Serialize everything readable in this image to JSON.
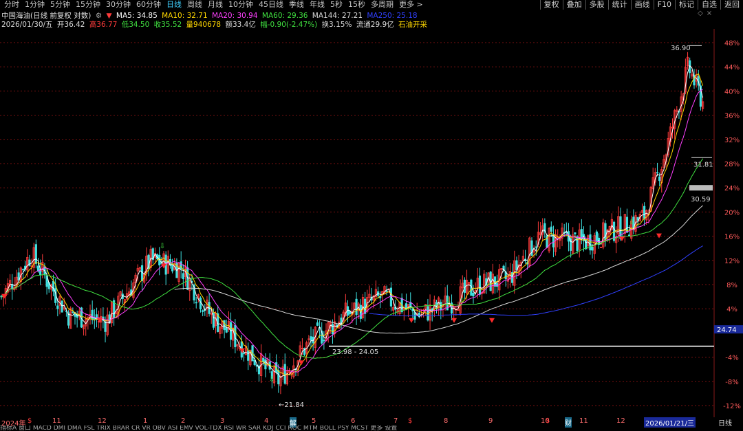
{
  "periods": [
    "分时",
    "1分钟",
    "5分钟",
    "15分钟",
    "30分钟",
    "60分钟",
    "日线",
    "周线",
    "月线",
    "10分钟",
    "45日线",
    "季线",
    "年线",
    "5秒",
    "15秒",
    "多周期",
    "更多 >"
  ],
  "active_period": "日线",
  "tools": [
    "复权",
    "叠加",
    "多股",
    "统计",
    "画线",
    "F10",
    "标记",
    "自选",
    "返回"
  ],
  "stock": {
    "title": "中国海油(日线 前复权 对数)",
    "ma5": "MA5: 34.85",
    "ma10": "MA10: 32.71",
    "ma20": "MA20: 30.94",
    "ma60": "MA60: 29.36",
    "ma144": "MA144: 27.21",
    "ma250": "MA250: 25.18",
    "date": "2026/01/30/五",
    "open": "开36.42",
    "high": "高36.77",
    "low": "低34.50",
    "close": "收35.52",
    "volume": "量940678",
    "amount": "额33.4亿",
    "change": "幅-0.90(-2.47%)",
    "turnover": "换3.15%",
    "float": "流通29.9亿",
    "sector": "石油开采"
  },
  "colors": {
    "up": "#ff3b3b",
    "down": "#3fe0e0",
    "ma5": "#ffffff",
    "ma10": "#ffd700",
    "ma20": "#ff40ff",
    "ma60": "#40e040",
    "ma144": "#d8d8d8",
    "ma250": "#3040ff",
    "grid": "#7a1010"
  },
  "y_axis": [
    "48%",
    "44%",
    "40%",
    "36%",
    "32%",
    "28%",
    "24%",
    "20%",
    "16%",
    "12%",
    "8%",
    "4%",
    "-4%",
    "-8%",
    "-12%"
  ],
  "price_tag": "24.74",
  "annotations": {
    "high_label": "36.90",
    "low_label": "21.84",
    "band_label": "23.98 - 24.05",
    "level1": "31.81",
    "level2": "30.59"
  },
  "x_axis": [
    "2024年",
    "11",
    "12",
    "1",
    "2",
    "3",
    "4",
    "5",
    "6",
    "7",
    "8",
    "9",
    "10",
    "11",
    "12",
    "2026/01/21/三"
  ],
  "event_marks": [
    "$",
    "解",
    "$",
    "$",
    "财"
  ],
  "bottom_right_label": "日线",
  "indicator_tabs": "指标A 窗口 MACD DMI DMA FSL TRIX BRAR CR VR OBV ASI EMV VOL-TDX RSI WR SAR KDJ CCI ROC MTM BOLL PSY MCST 更多 设置",
  "chart_data": {
    "type": "candlestick",
    "title": "中国海油(日线 前复权 对数)",
    "y_range_pct": [
      -13,
      50
    ],
    "series": [
      {
        "name": "MA5"
      },
      {
        "name": "MA10"
      },
      {
        "name": "MA20"
      },
      {
        "name": "MA60"
      },
      {
        "name": "MA144"
      },
      {
        "name": "MA250"
      }
    ],
    "last_close": 35.52,
    "max_price": 36.9,
    "min_price": 21.84
  }
}
